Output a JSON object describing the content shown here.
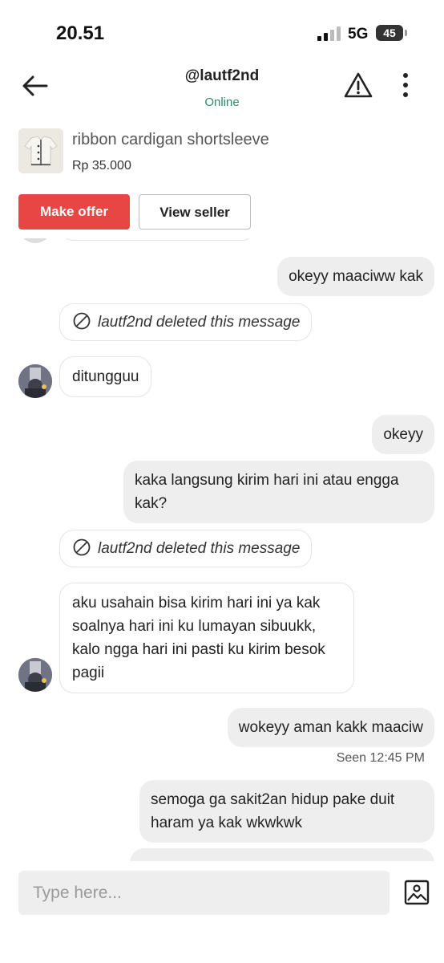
{
  "status_bar": {
    "time": "20.51",
    "network": "5G",
    "battery": "45"
  },
  "header": {
    "username": "@lautf2nd",
    "presence": "Online"
  },
  "product": {
    "name": "ribbon cardigan shortsleeve",
    "price": "Rp 35.000"
  },
  "actions": {
    "make_offer": "Make offer",
    "view_seller": "View seller"
  },
  "messages": [
    {
      "from": "me",
      "text": "okeyy maaciww kak"
    },
    {
      "from": "seller",
      "deleted": true,
      "text": "lautf2nd deleted this message"
    },
    {
      "from": "seller",
      "text": "ditungguu"
    },
    {
      "from": "me",
      "text": "okeyy"
    },
    {
      "from": "me",
      "text": "kaka langsung kirim hari ini atau engga kak?"
    },
    {
      "from": "seller",
      "deleted": true,
      "text": "lautf2nd deleted this message"
    },
    {
      "from": "seller",
      "text": "aku usahain bisa kirim hari ini ya kak soalnya hari ini ku lumayan sibuukk, kalo ngga hari ini pasti ku kirim besok pagii"
    },
    {
      "from": "me",
      "text": "wokeyy aman kakk maaciw",
      "seen": "Seen 12:45 PM"
    },
    {
      "from": "me",
      "text": "semoga ga sakit2an hidup pake duit haram ya kak wkwkwk"
    }
  ],
  "composer": {
    "placeholder": "Type here..."
  },
  "icons": [
    "back-arrow-icon",
    "warning-icon",
    "more-vertical-icon",
    "ban-icon",
    "image-icon"
  ],
  "colors": {
    "accent": "#e84545",
    "online": "#2e8b6b",
    "outgoing_bubble": "#eeeeee"
  }
}
